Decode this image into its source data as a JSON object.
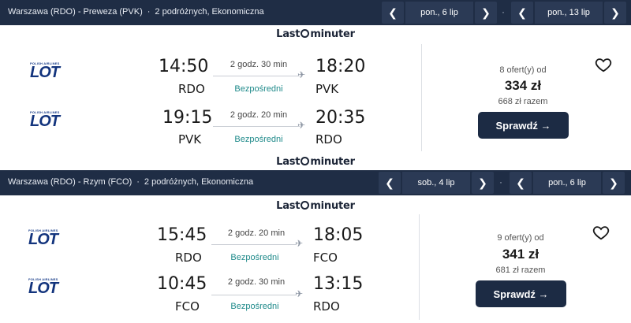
{
  "colors": {
    "bar_bg": "#1f2d45",
    "accent_teal": "#1f8a8a",
    "button_bg": "#1c2b44"
  },
  "logo_text": {
    "left": "Last",
    "right": "minuter"
  },
  "results": [
    {
      "header": {
        "route": "Warszawa (RDO) - Preweza (PVK)",
        "pax": "2 podróżnych, Ekonomiczna",
        "outbound_date": "pon., 6 lip",
        "return_date": "pon., 13 lip",
        "dot": "·"
      },
      "legs": [
        {
          "airline_tiny": "POLISH AIRLINES",
          "airline": "LOT",
          "dep_time": "14:50",
          "dep_code": "RDO",
          "duration": "2 godz. 30 min",
          "stops": "Bezpośredni",
          "arr_time": "18:20",
          "arr_code": "PVK"
        },
        {
          "airline_tiny": "POLISH AIRLINES",
          "airline": "LOT",
          "dep_time": "19:15",
          "dep_code": "PVK",
          "duration": "2 godz. 20 min",
          "stops": "Bezpośredni",
          "arr_time": "20:35",
          "arr_code": "RDO"
        }
      ],
      "offers": "8 ofert(y) od",
      "price": "334 zł",
      "total": "668 zł razem",
      "button": "Sprawdź →"
    },
    {
      "header": {
        "route": "Warszawa (RDO) - Rzym (FCO)",
        "pax": "2 podróżnych, Ekonomiczna",
        "outbound_date": "sob., 4 lip",
        "return_date": "pon., 6 lip",
        "dot": "·"
      },
      "legs": [
        {
          "airline_tiny": "POLISH AIRLINES",
          "airline": "LOT",
          "dep_time": "15:45",
          "dep_code": "RDO",
          "duration": "2 godz. 20 min",
          "stops": "Bezpośredni",
          "arr_time": "18:05",
          "arr_code": "FCO"
        },
        {
          "airline_tiny": "POLISH AIRLINES",
          "airline": "LOT",
          "dep_time": "10:45",
          "dep_code": "FCO",
          "duration": "2 godz. 30 min",
          "stops": "Bezpośredni",
          "arr_time": "13:15",
          "arr_code": "RDO"
        }
      ],
      "offers": "9 ofert(y) od",
      "price": "341 zł",
      "total": "681 zł razem",
      "button": "Sprawdź →"
    }
  ],
  "icons": {
    "prev": "chevron-left-icon",
    "next": "chevron-right-icon",
    "favorite": "heart-outline-icon",
    "plane": "airplane-icon"
  }
}
